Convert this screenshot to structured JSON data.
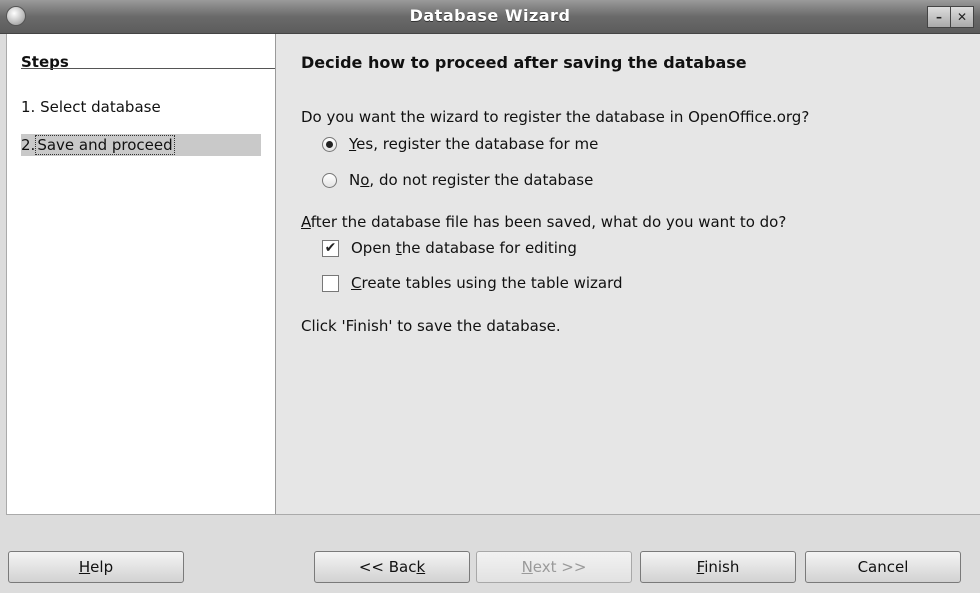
{
  "window": {
    "title": "Database Wizard"
  },
  "steps": {
    "heading": "Steps",
    "items": [
      {
        "number": "1.",
        "label": "Select database"
      },
      {
        "number": "2.",
        "label": "Save and proceed"
      }
    ]
  },
  "page": {
    "heading": "Decide how to proceed after saving the database",
    "register_question": "Do you want the wizard to register the database in OpenOffice.org?",
    "register_yes": {
      "mnemonic": "Y",
      "rest": "es, register the database for me",
      "selected": true
    },
    "register_no": {
      "pre": "N",
      "mnemonic": "o",
      "rest": ", do not register the database",
      "selected": false
    },
    "after_question": {
      "mnemonic": "A",
      "rest": "fter the database file has been saved, what do you want to do?"
    },
    "open_option": {
      "pre": "Open ",
      "mnemonic": "t",
      "rest": "he database for editing",
      "checked": true
    },
    "create_option": {
      "mnemonic": "C",
      "rest": "reate tables using the table wizard",
      "checked": false
    },
    "finish_note": "Click 'Finish' to save the database."
  },
  "buttons": {
    "help": {
      "mnemonic": "H",
      "rest": "elp"
    },
    "back": {
      "pre": "<< Bac",
      "mnemonic": "k",
      "rest": ""
    },
    "next": {
      "mnemonic": "N",
      "rest": "ext >>"
    },
    "finish": {
      "mnemonic": "F",
      "rest": "inish"
    },
    "cancel": "Cancel"
  },
  "checkmark_glyph": "✔"
}
